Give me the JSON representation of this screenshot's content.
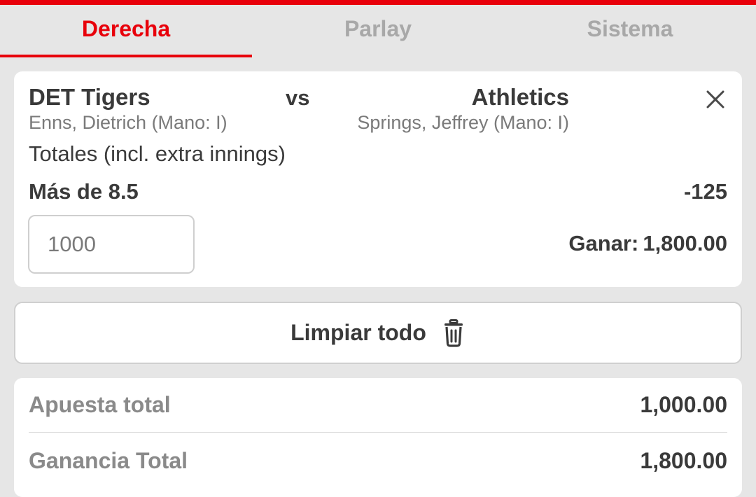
{
  "tabs": [
    {
      "label": "Derecha",
      "active": true
    },
    {
      "label": "Parlay",
      "active": false
    },
    {
      "label": "Sistema",
      "active": false
    }
  ],
  "bet": {
    "home_team": "DET Tigers",
    "vs_label": "vs",
    "away_team": "Athletics",
    "home_pitcher": "Enns, Dietrich (Mano: I)",
    "away_pitcher": "Springs, Jeffrey (Mano: I)",
    "market": "Totales (incl. extra innings)",
    "selection": "Más de 8.5",
    "odds": "-125",
    "stake_value": "1000",
    "win_label": "Ganar:",
    "win_value": "1,800.00",
    "close_icon": "close-icon"
  },
  "clear_all": {
    "label": "Limpiar todo",
    "icon": "trash-icon"
  },
  "summary": {
    "total_stake_label": "Apuesta total",
    "total_stake_value": "1,000.00",
    "total_win_label": "Ganancia Total",
    "total_win_value": "1,800.00"
  },
  "colors": {
    "accent": "#e8000b",
    "background": "#e6e6e6",
    "card": "#ffffff",
    "text": "#3a3a3a",
    "muted": "#a8a8a8"
  }
}
